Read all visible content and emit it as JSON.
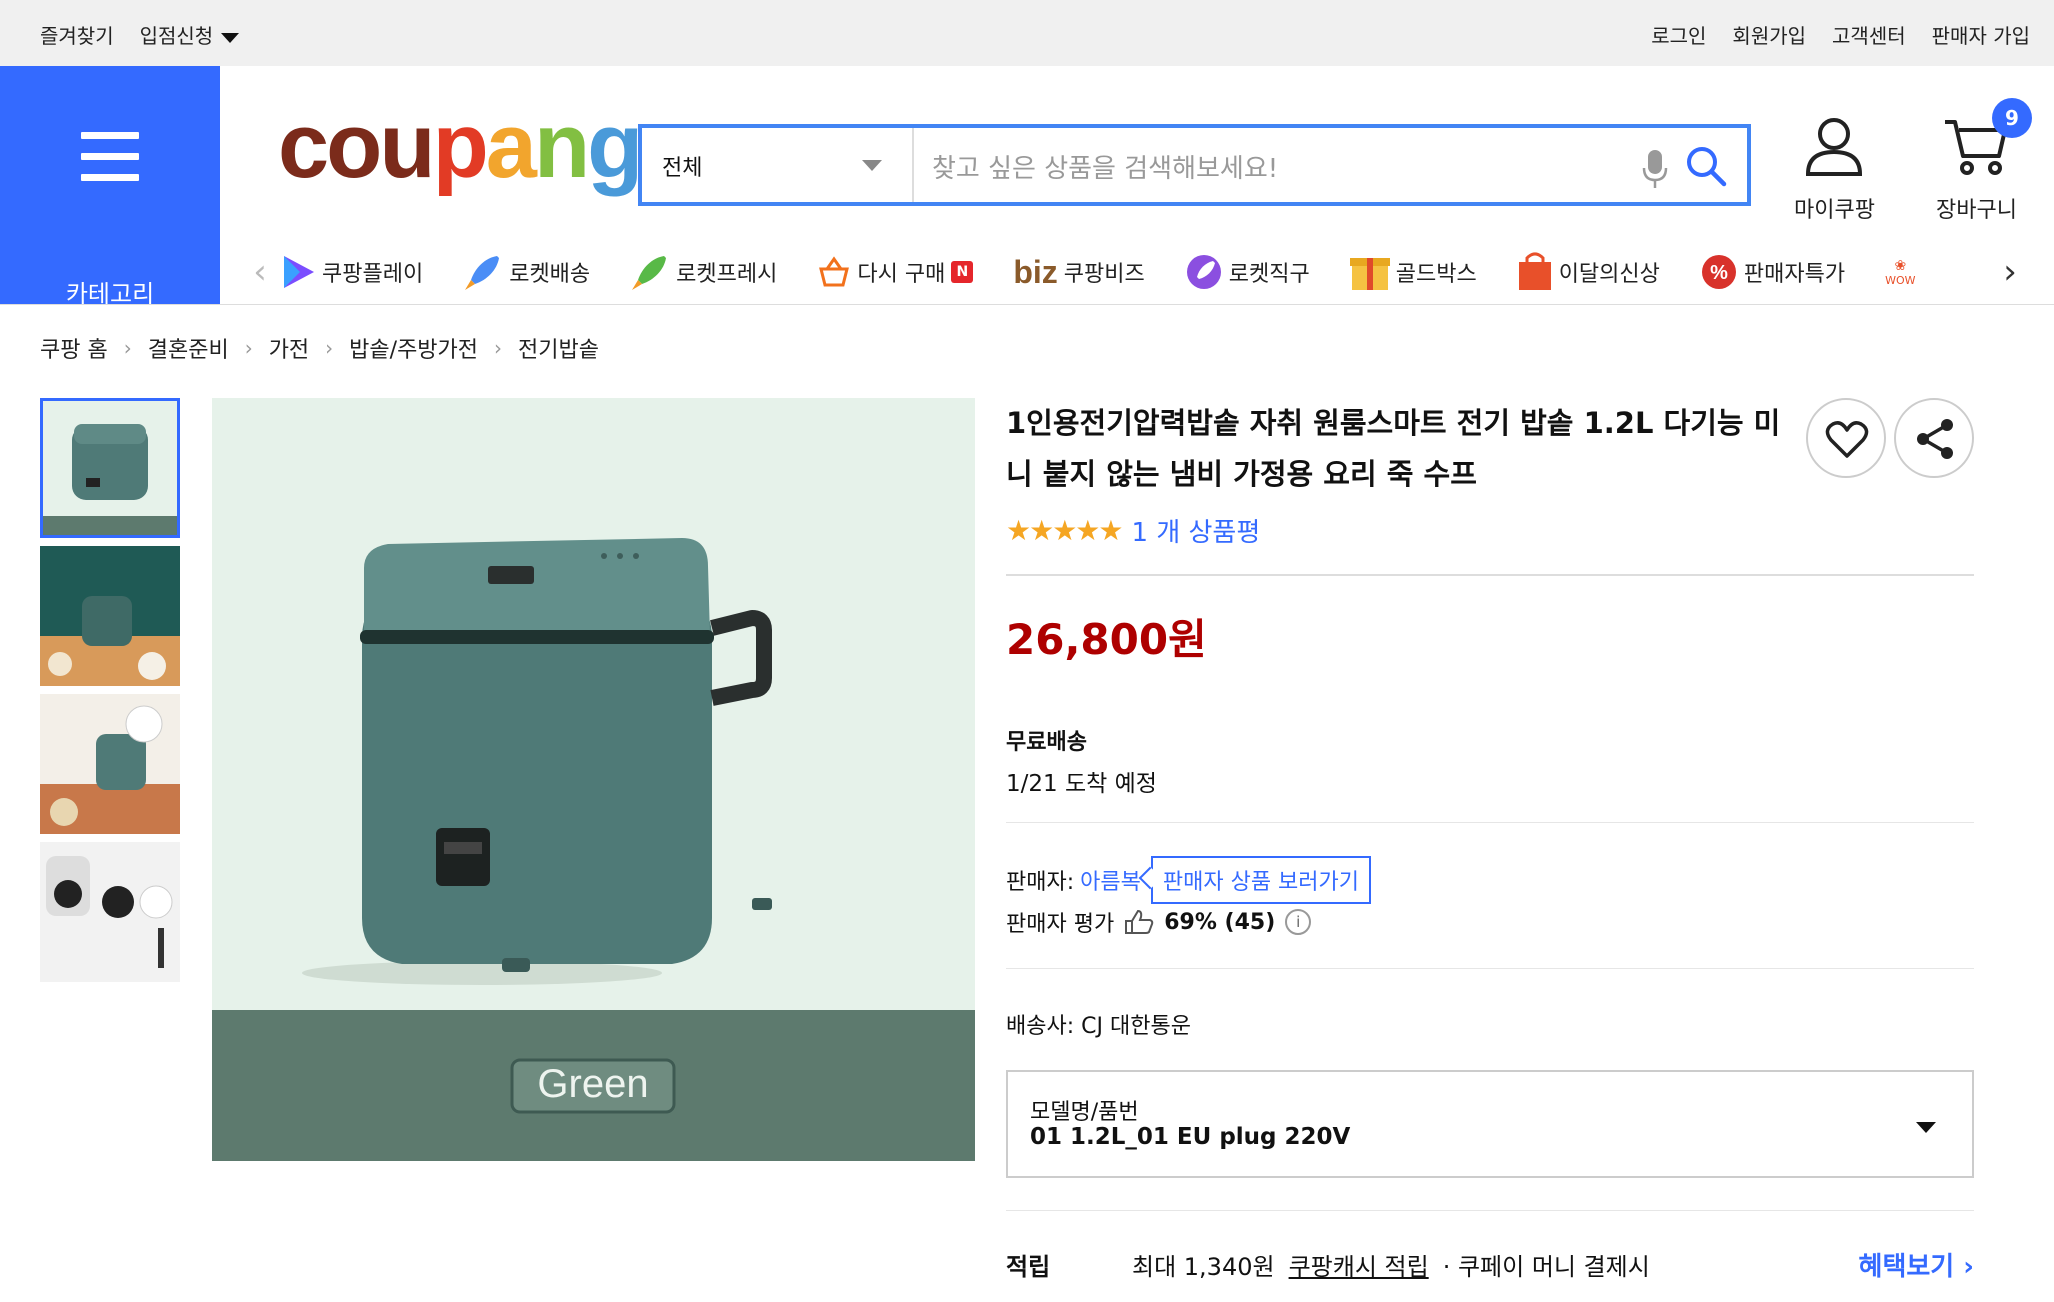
{
  "topbar": {
    "bookmark": "즐겨찾기",
    "apply": "입점신청",
    "login": "로그인",
    "signup": "회원가입",
    "support": "고객센터",
    "seller_join": "판매자 가입"
  },
  "header": {
    "category_label": "카테고리",
    "logo": [
      "cou",
      "p",
      "a",
      "n",
      "g"
    ],
    "search_scope": "전체",
    "search_placeholder": "찾고 싶은 상품을 검색해보세요!",
    "mypage": "마이쿠팡",
    "cart": "장바구니",
    "cart_count": "9"
  },
  "quicknav": {
    "items": [
      "쿠팡플레이",
      "로켓배송",
      "로켓프레시",
      "다시 구매",
      "쿠팡비즈",
      "로켓직구",
      "골드박스",
      "이달의신상",
      "판매자특가"
    ],
    "rebuy_badge": "N",
    "biz_prefix": "biz",
    "wow": "WOW"
  },
  "breadcrumb": [
    "쿠팡 홈",
    "결혼준비",
    "가전",
    "밥솥/주방가전",
    "전기밥솥"
  ],
  "product": {
    "title": "1인용전기압력밥솥 자취 원룸스마트 전기 밥솥 1.2L 다기능 미니 붙지 않는 냄비 가정용 요리 죽 수프",
    "stars": "★★★★★",
    "review_link": "1 개 상품평",
    "price": "26,800원",
    "shipping_label": "무료배송",
    "eta": "1/21 도착 예정",
    "seller_prefix": "판매자:",
    "seller_name": "아름복",
    "seller_button": "판매자 상품 보러가기",
    "seller_rating_label": "판매자 평가",
    "seller_rating": "69% (45)",
    "carrier": "배송사:  CJ 대한통운",
    "option_label": "모델명/품번",
    "option_value": "01 1.2L_01 EU plug 220V",
    "reward_label": "적립",
    "reward_text": "최대 1,340원",
    "reward_link": "쿠팡캐시 적립",
    "reward_tail": "· 쿠페이 머니 결제시",
    "reward_more": "혜택보기 ›",
    "image_label": "Green"
  },
  "colors": {
    "accent": "#346aff",
    "price": "#ae0000",
    "product_teal": "#4f7a77"
  }
}
